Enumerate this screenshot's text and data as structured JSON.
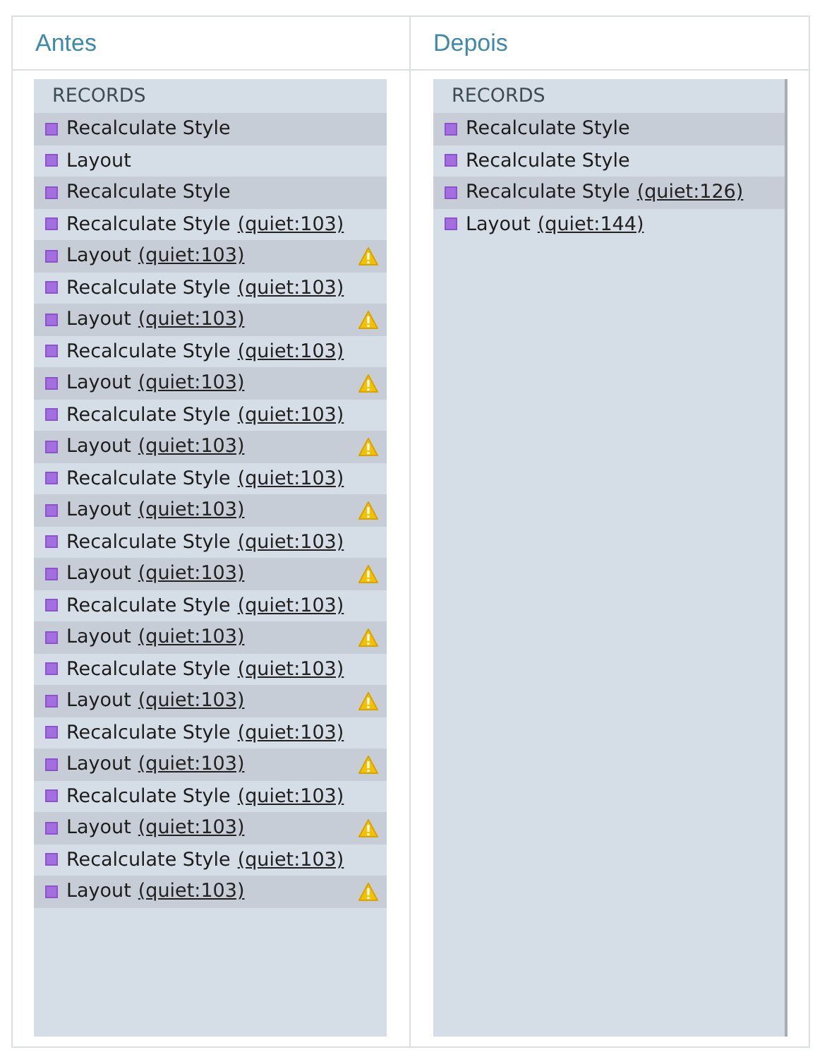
{
  "columns": [
    {
      "title": "Antes",
      "panel": {
        "header": "RECORDS",
        "records": [
          {
            "name": "Recalculate Style",
            "warning": false
          },
          {
            "name": "Layout",
            "warning": false
          },
          {
            "name": "Recalculate Style",
            "warning": false
          },
          {
            "name": "Recalculate Style",
            "link": "(quiet:103)",
            "warning": false
          },
          {
            "name": "Layout",
            "link": "(quiet:103)",
            "warning": true
          },
          {
            "name": "Recalculate Style",
            "link": "(quiet:103)",
            "warning": false
          },
          {
            "name": "Layout",
            "link": "(quiet:103)",
            "warning": true
          },
          {
            "name": "Recalculate Style",
            "link": "(quiet:103)",
            "warning": false
          },
          {
            "name": "Layout",
            "link": "(quiet:103)",
            "warning": true
          },
          {
            "name": "Recalculate Style",
            "link": "(quiet:103)",
            "warning": false
          },
          {
            "name": "Layout",
            "link": "(quiet:103)",
            "warning": true
          },
          {
            "name": "Recalculate Style",
            "link": "(quiet:103)",
            "warning": false
          },
          {
            "name": "Layout",
            "link": "(quiet:103)",
            "warning": true
          },
          {
            "name": "Recalculate Style",
            "link": "(quiet:103)",
            "warning": false
          },
          {
            "name": "Layout",
            "link": "(quiet:103)",
            "warning": true
          },
          {
            "name": "Recalculate Style",
            "link": "(quiet:103)",
            "warning": false
          },
          {
            "name": "Layout",
            "link": "(quiet:103)",
            "warning": true
          },
          {
            "name": "Recalculate Style",
            "link": "(quiet:103)",
            "warning": false
          },
          {
            "name": "Layout",
            "link": "(quiet:103)",
            "warning": true
          },
          {
            "name": "Recalculate Style",
            "link": "(quiet:103)",
            "warning": false
          },
          {
            "name": "Layout",
            "link": "(quiet:103)",
            "warning": true
          },
          {
            "name": "Recalculate Style",
            "link": "(quiet:103)",
            "warning": false
          },
          {
            "name": "Layout",
            "link": "(quiet:103)",
            "warning": true
          },
          {
            "name": "Recalculate Style",
            "link": "(quiet:103)",
            "warning": false
          },
          {
            "name": "Layout",
            "link": "(quiet:103)",
            "warning": true
          }
        ]
      }
    },
    {
      "title": "Depois",
      "panel": {
        "header": "RECORDS",
        "records": [
          {
            "name": "Recalculate Style",
            "warning": false
          },
          {
            "name": "Recalculate Style",
            "warning": false
          },
          {
            "name": "Recalculate Style",
            "link": "(quiet:126)",
            "warning": false
          },
          {
            "name": "Layout",
            "link": "(quiet:144)",
            "warning": false
          }
        ]
      }
    }
  ]
}
